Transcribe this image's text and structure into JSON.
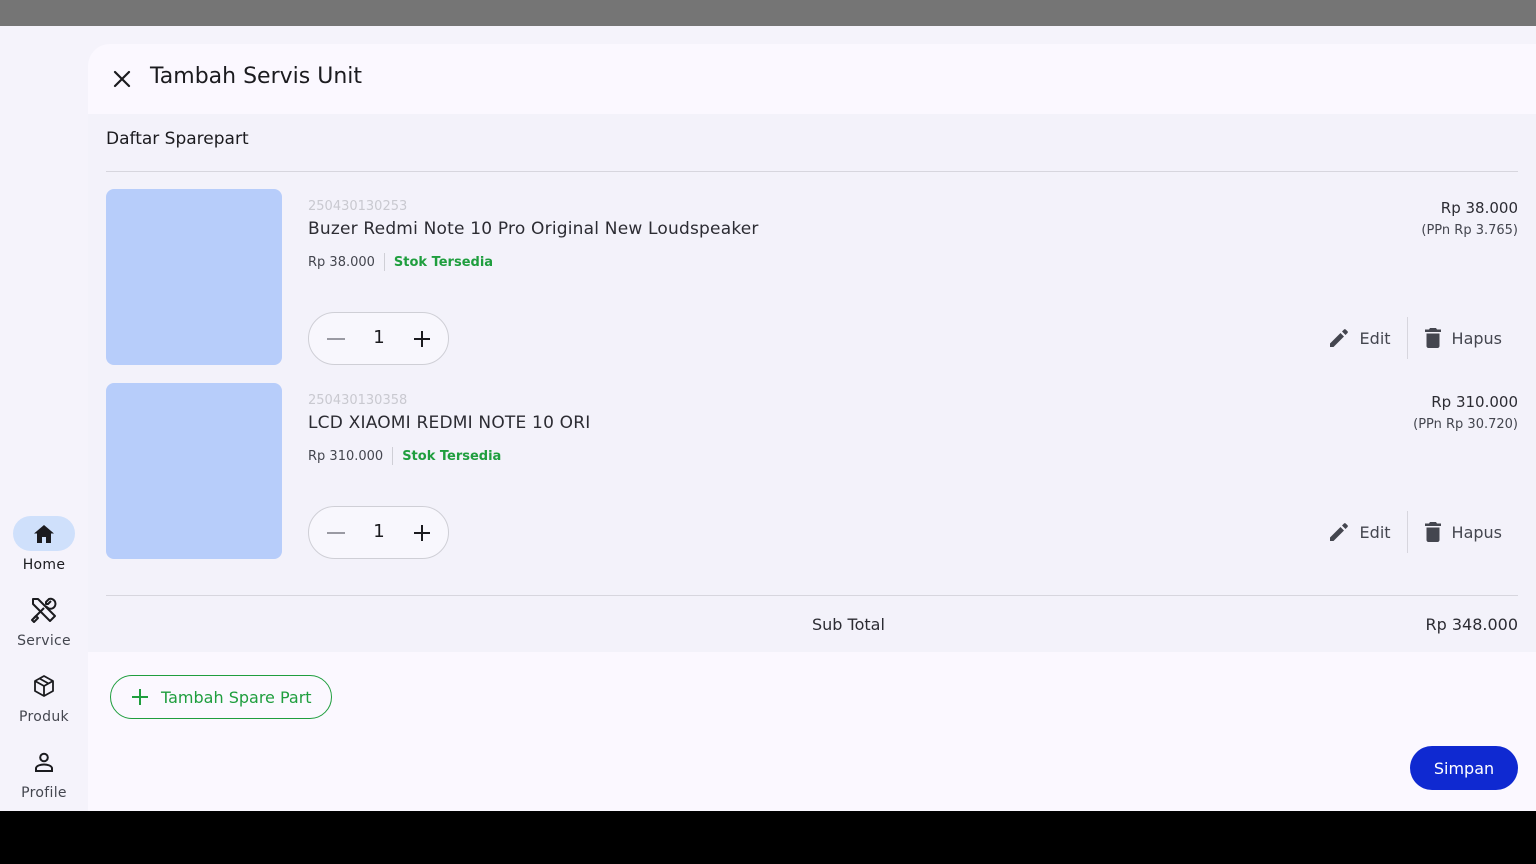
{
  "nav": {
    "items": [
      {
        "label": "Home",
        "icon": "home-icon",
        "active": true
      },
      {
        "label": "Service",
        "icon": "tools-icon",
        "active": false
      },
      {
        "label": "Produk",
        "icon": "box-icon",
        "active": false
      },
      {
        "label": "Profile",
        "icon": "person-icon",
        "active": false
      }
    ]
  },
  "dialog": {
    "title": "Tambah Servis Unit",
    "close_icon": "close-icon"
  },
  "spareparts": {
    "section_title": "Daftar Sparepart",
    "items": [
      {
        "sku": "250430130253",
        "name": "Buzer Redmi Note 10 Pro Original New Loudspeaker",
        "unit_price": "Rp 38.000",
        "stock": "Stok Tersedia",
        "total": "Rp 38.000",
        "tax": "(PPn Rp 3.765)",
        "qty": "1",
        "edit_label": "Edit",
        "delete_label": "Hapus"
      },
      {
        "sku": "250430130358",
        "name": "LCD XIAOMI REDMI NOTE 10 ORI",
        "unit_price": "Rp 310.000",
        "stock": "Stok Tersedia",
        "total": "Rp 310.000",
        "tax": "(PPn Rp 30.720)",
        "qty": "1",
        "edit_label": "Edit",
        "delete_label": "Hapus"
      }
    ],
    "subtotal_label": "Sub Total",
    "subtotal_value": "Rp 348.000"
  },
  "actions": {
    "add_label": "Tambah Spare Part",
    "save_label": "Simpan"
  },
  "colors": {
    "accent_green": "#1f9e3e",
    "primary_blue": "#0f29d1",
    "thumb_placeholder": "#b7cdfa"
  }
}
